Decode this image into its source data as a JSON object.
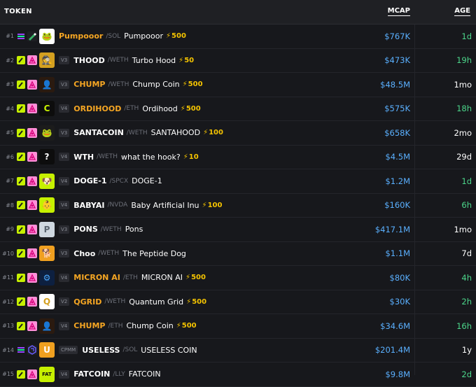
{
  "header": {
    "token": "TOKEN",
    "mcap": "MCAP",
    "age": "AGE"
  },
  "colors": {
    "accent_orange": "#f5a623",
    "mcap_blue": "#5ab0ff",
    "age_green": "#4cd78b",
    "boost_yellow": "#f5c400"
  },
  "rows": [
    {
      "rank": "#1",
      "chain": "sol",
      "dex": "pump",
      "logo": "pumpooor-logo",
      "ver": "",
      "symbol": "Pumpooor",
      "orange": true,
      "pair": "/SOL",
      "name": "Pumpooor",
      "boost": "500",
      "mcap": "$767K",
      "age": "1d",
      "age_color": "green"
    },
    {
      "rank": "#2",
      "chain": "base",
      "dex": "uni",
      "logo": "thood-logo",
      "ver": "V3",
      "symbol": "THOOD",
      "orange": false,
      "pair": "/WETH",
      "name": "Turbo Hood",
      "boost": "50",
      "mcap": "$473K",
      "age": "19h",
      "age_color": "green"
    },
    {
      "rank": "#3",
      "chain": "base",
      "dex": "uni",
      "logo": "chump-logo",
      "ver": "V3",
      "symbol": "CHUMP",
      "orange": true,
      "pair": "/WETH",
      "name": "Chump Coin",
      "boost": "500",
      "mcap": "$48.5M",
      "age": "1mo",
      "age_color": "white"
    },
    {
      "rank": "#4",
      "chain": "base",
      "dex": "uni",
      "logo": "ordihood-logo",
      "ver": "V4",
      "symbol": "ORDIHOOD",
      "orange": true,
      "pair": "/ETH",
      "name": "Ordihood",
      "boost": "500",
      "mcap": "$575K",
      "age": "18h",
      "age_color": "green"
    },
    {
      "rank": "#5",
      "chain": "base",
      "dex": "uni",
      "logo": "santacoin-logo",
      "ver": "V3",
      "symbol": "SANTACOIN",
      "orange": false,
      "pair": "/WETH",
      "name": "SANTAHOOD",
      "boost": "100",
      "mcap": "$658K",
      "age": "2mo",
      "age_color": "white"
    },
    {
      "rank": "#6",
      "chain": "base",
      "dex": "uni",
      "logo": "wth-logo",
      "ver": "V4",
      "symbol": "WTH",
      "orange": false,
      "pair": "/WETH",
      "name": "what the hook?",
      "boost": "10",
      "mcap": "$4.5M",
      "age": "29d",
      "age_color": "white"
    },
    {
      "rank": "#7",
      "chain": "base",
      "dex": "uni",
      "logo": "doge-logo",
      "ver": "V4",
      "symbol": "DOGE-1",
      "orange": false,
      "pair": "/SPCX",
      "name": "DOGE-1",
      "boost": "",
      "mcap": "$1.2M",
      "age": "1d",
      "age_color": "green"
    },
    {
      "rank": "#8",
      "chain": "base",
      "dex": "uni",
      "logo": "babyai-logo",
      "ver": "V4",
      "symbol": "BABYAI",
      "orange": false,
      "pair": "/NVDA",
      "name": "Baby Artificial Inu",
      "boost": "100",
      "mcap": "$160K",
      "age": "6h",
      "age_color": "green"
    },
    {
      "rank": "#9",
      "chain": "base",
      "dex": "uni",
      "logo": "pons-logo",
      "ver": "V3",
      "symbol": "PONS",
      "orange": false,
      "pair": "/WETH",
      "name": "Pons",
      "boost": "",
      "mcap": "$417.1M",
      "age": "1mo",
      "age_color": "white"
    },
    {
      "rank": "#10",
      "chain": "base",
      "dex": "uni",
      "logo": "choo-logo",
      "ver": "V3",
      "symbol": "Choo",
      "orange": false,
      "pair": "/WETH",
      "name": "The Peptide Dog",
      "boost": "",
      "mcap": "$1.1M",
      "age": "7d",
      "age_color": "white"
    },
    {
      "rank": "#11",
      "chain": "base",
      "dex": "uni",
      "logo": "micronai-logo",
      "ver": "V4",
      "symbol": "MICRON AI",
      "orange": true,
      "pair": "/ETH",
      "name": "MICRON AI",
      "boost": "500",
      "mcap": "$80K",
      "age": "4h",
      "age_color": "green"
    },
    {
      "rank": "#12",
      "chain": "base",
      "dex": "uni",
      "logo": "qgrid-logo",
      "ver": "V2",
      "symbol": "QGRID",
      "orange": true,
      "pair": "/WETH",
      "name": "Quantum Grid",
      "boost": "500",
      "mcap": "$30K",
      "age": "2h",
      "age_color": "green"
    },
    {
      "rank": "#13",
      "chain": "base",
      "dex": "uni",
      "logo": "chump-logo",
      "ver": "V4",
      "symbol": "CHUMP",
      "orange": true,
      "pair": "/ETH",
      "name": "Chump Coin",
      "boost": "500",
      "mcap": "$34.6M",
      "age": "16h",
      "age_color": "green"
    },
    {
      "rank": "#14",
      "chain": "sol",
      "dex": "raydium",
      "logo": "useless-logo",
      "ver": "CPMM",
      "symbol": "USELESS",
      "orange": false,
      "pair": "/SOL",
      "name": "USELESS COIN",
      "boost": "",
      "mcap": "$201.4M",
      "age": "1y",
      "age_color": "white"
    },
    {
      "rank": "#15",
      "chain": "base",
      "dex": "uni",
      "logo": "fatcoin-logo",
      "ver": "V4",
      "symbol": "FATCOIN",
      "orange": false,
      "pair": "/LLY",
      "name": "FATCOIN",
      "boost": "",
      "mcap": "$9.8M",
      "age": "2d",
      "age_color": "green"
    }
  ]
}
